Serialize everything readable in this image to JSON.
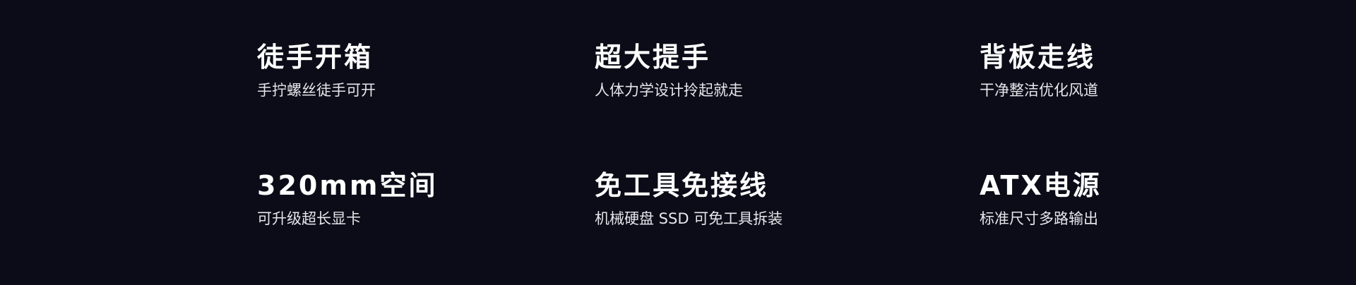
{
  "features": [
    {
      "title": "徒手开箱",
      "desc": "手拧螺丝徒手可开"
    },
    {
      "title": "超大提手",
      "desc": "人体力学设计拎起就走"
    },
    {
      "title": "背板走线",
      "desc": "干净整洁优化风道"
    },
    {
      "title": "320mm空间",
      "desc": "可升级超长显卡"
    },
    {
      "title": "免工具免接线",
      "desc": "机械硬盘 SSD 可免工具拆装"
    },
    {
      "title": "ATX电源",
      "desc": "标准尺寸多路输出"
    }
  ],
  "colors": {
    "background": "#0c0c18",
    "title": "#ffffff",
    "description": "#e6e6ec"
  }
}
